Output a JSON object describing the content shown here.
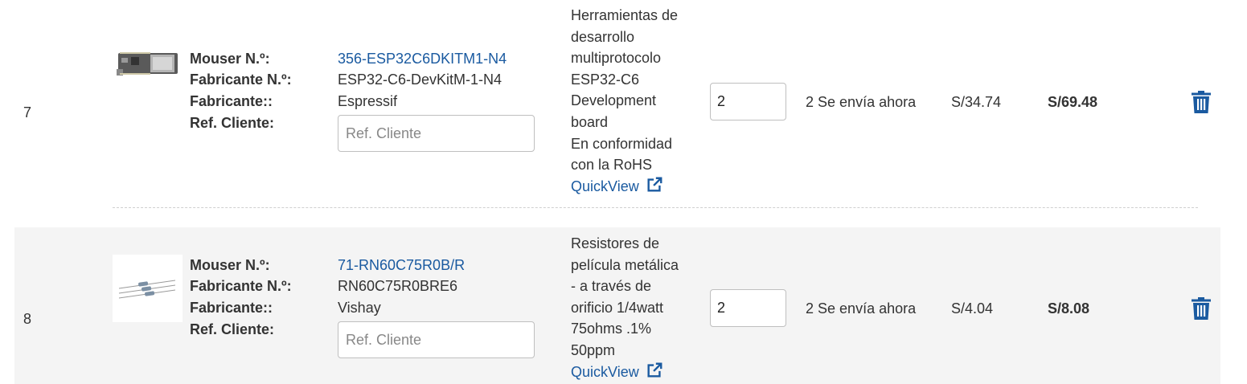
{
  "labels": {
    "mouser_no": "Mouser N.º:",
    "mfr_no": "Fabricante N.º:",
    "mfr": "Fabricante::",
    "ref": "Ref. Cliente:"
  },
  "ref_placeholder": "Ref. Cliente",
  "quickview_label": "QuickView",
  "colors": {
    "link": "#1a5aa0",
    "row_alt_bg": "#f4f4f4"
  },
  "items": [
    {
      "line_no": "7",
      "image_icon": "dev-board-thumbnail",
      "mouser_no": "356-ESP32C6DKITM1-N4",
      "mfr_no": "ESP32-C6-DevKitM-1-N4",
      "mfr": "Espressif",
      "description_lines": [
        "Herramientas de",
        "desarrollo",
        "multiprotocolo",
        "ESP32-C6",
        "Development",
        "board",
        "En conformidad",
        "con la RoHS"
      ],
      "qty": "2",
      "avail_qty": "2",
      "avail_text": "Se envía ahora",
      "unit_price": "S/34.74",
      "ext_price": "S/69.48"
    },
    {
      "line_no": "8",
      "image_icon": "resistor-thumbnail",
      "mouser_no": "71-RN60C75R0B/R",
      "mfr_no": "RN60C75R0BRE6",
      "mfr": "Vishay",
      "description_lines": [
        "Resistores de",
        "película metálica",
        "- a través de",
        "orificio 1/4watt",
        "75ohms .1%",
        "50ppm"
      ],
      "qty": "2",
      "avail_qty": "2",
      "avail_text": "Se envía ahora",
      "unit_price": "S/4.04",
      "ext_price": "S/8.08"
    }
  ]
}
